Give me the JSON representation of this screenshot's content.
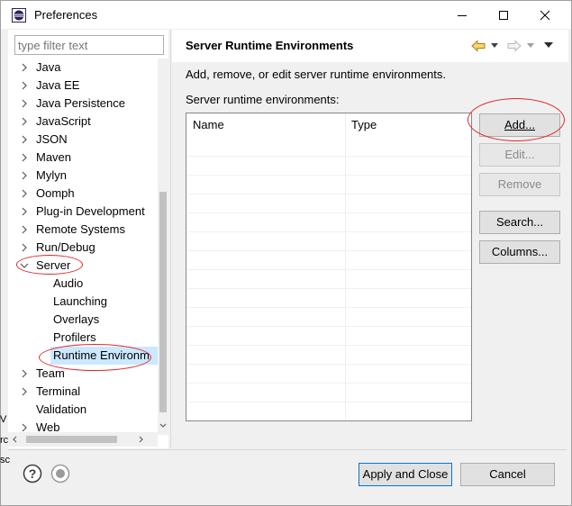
{
  "window": {
    "title": "Preferences"
  },
  "filter": {
    "placeholder": "type filter text"
  },
  "tree": [
    {
      "label": "Java",
      "expand": "collapsed",
      "indent": 0
    },
    {
      "label": "Java EE",
      "expand": "collapsed",
      "indent": 0
    },
    {
      "label": "Java Persistence",
      "expand": "collapsed",
      "indent": 0
    },
    {
      "label": "JavaScript",
      "expand": "collapsed",
      "indent": 0
    },
    {
      "label": "JSON",
      "expand": "collapsed",
      "indent": 0
    },
    {
      "label": "Maven",
      "expand": "collapsed",
      "indent": 0
    },
    {
      "label": "Mylyn",
      "expand": "collapsed",
      "indent": 0
    },
    {
      "label": "Oomph",
      "expand": "collapsed",
      "indent": 0
    },
    {
      "label": "Plug-in Development",
      "expand": "collapsed",
      "indent": 0
    },
    {
      "label": "Remote Systems",
      "expand": "collapsed",
      "indent": 0
    },
    {
      "label": "Run/Debug",
      "expand": "collapsed",
      "indent": 0
    },
    {
      "label": "Server",
      "expand": "expanded",
      "indent": 0
    },
    {
      "label": "Audio",
      "expand": "none",
      "indent": 1
    },
    {
      "label": "Launching",
      "expand": "none",
      "indent": 1
    },
    {
      "label": "Overlays",
      "expand": "none",
      "indent": 1
    },
    {
      "label": "Profilers",
      "expand": "none",
      "indent": 1
    },
    {
      "label": "Runtime Environm",
      "expand": "none",
      "indent": 1,
      "selected": true
    },
    {
      "label": "Team",
      "expand": "collapsed",
      "indent": 0
    },
    {
      "label": "Terminal",
      "expand": "collapsed",
      "indent": 0
    },
    {
      "label": "Validation",
      "expand": "none",
      "indent": 0
    },
    {
      "label": "Web",
      "expand": "collapsed",
      "indent": 0
    }
  ],
  "page": {
    "title": "Server Runtime Environments",
    "description": "Add, remove, or edit server runtime environments.",
    "list_label": "Server runtime environments:"
  },
  "table": {
    "columns": [
      "Name",
      "Type"
    ],
    "rows": []
  },
  "buttons": {
    "add": "Add...",
    "edit": "Edit...",
    "remove": "Remove",
    "search": "Search...",
    "columns": "Columns..."
  },
  "footer": {
    "apply_close": "Apply and Close",
    "cancel": "Cancel"
  },
  "edge_text": [
    "V",
    "rc",
    "sc"
  ],
  "colors": {
    "selection": "#cce8ff",
    "annotation": "#e0262a",
    "accent": "#0078d7"
  }
}
